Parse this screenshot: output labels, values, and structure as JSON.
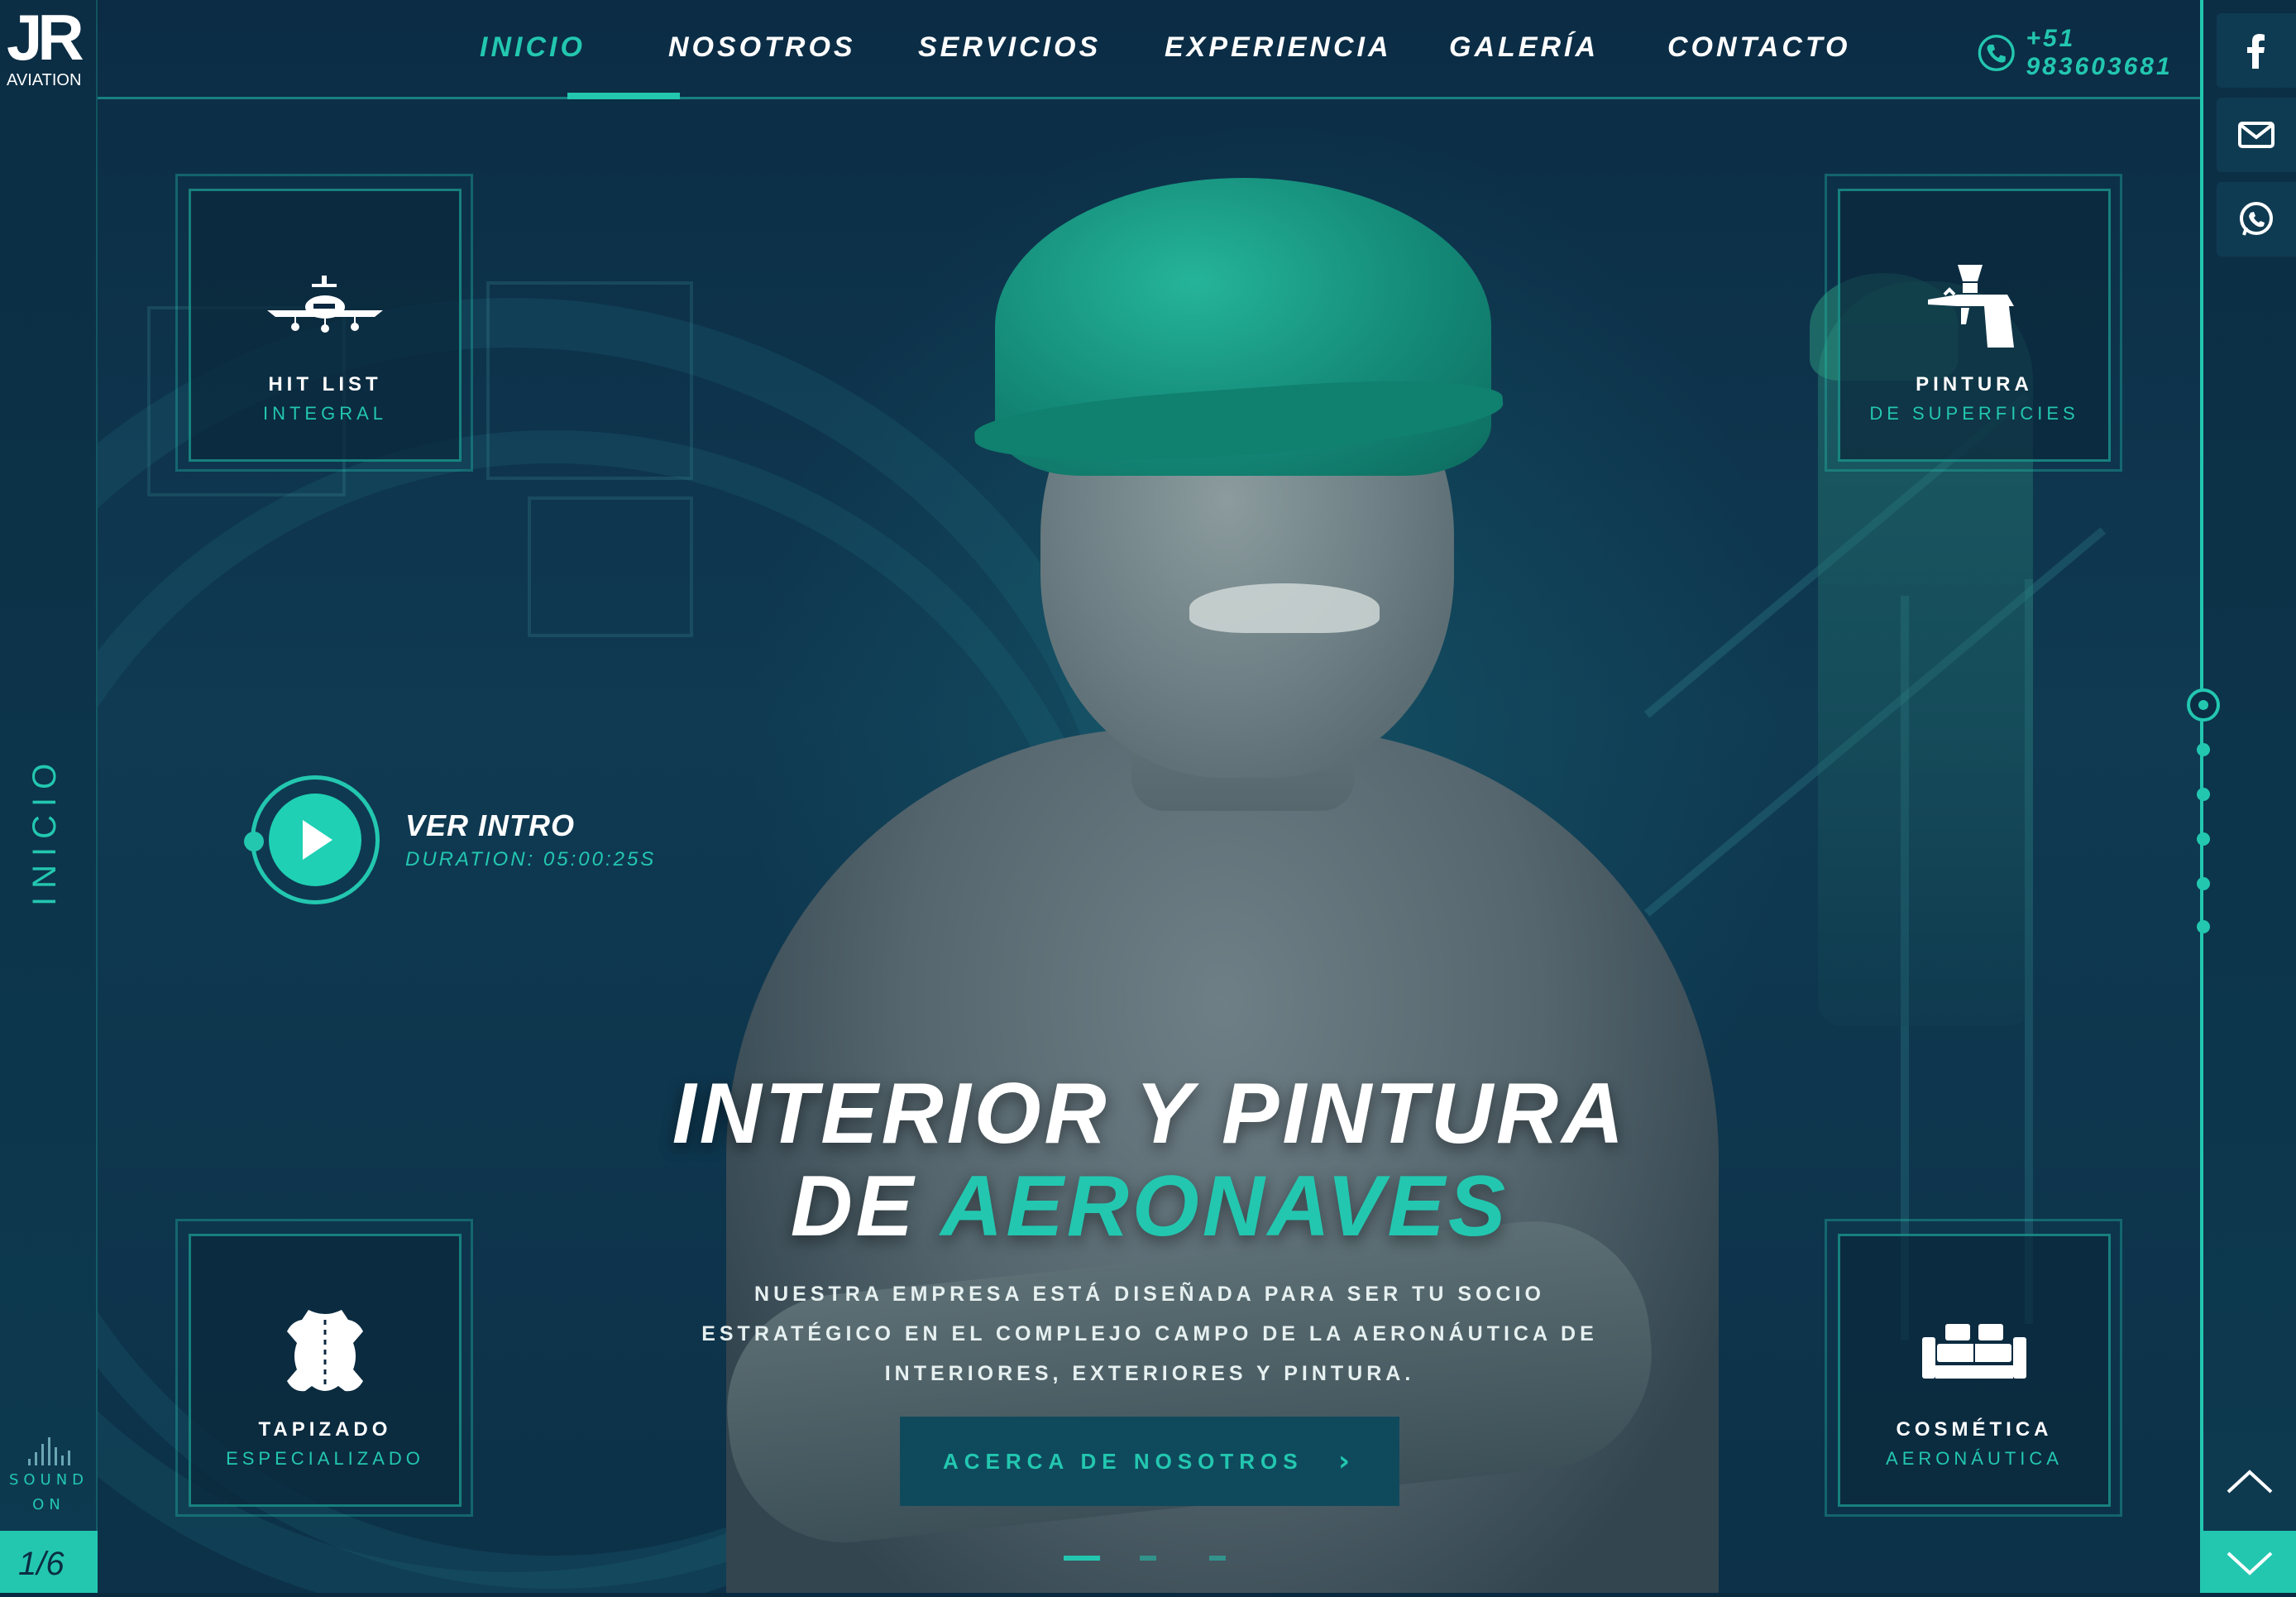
{
  "brand": {
    "logo_mark": "JR",
    "logo_sub": "AVIATION"
  },
  "nav": {
    "items": [
      {
        "label": "INICIO",
        "active": true
      },
      {
        "label": "NOSOTROS",
        "active": false
      },
      {
        "label": "SERVICIOS",
        "active": false
      },
      {
        "label": "EXPERIENCIA",
        "active": false
      },
      {
        "label": "GALERÍA",
        "active": false
      },
      {
        "label": "CONTACTO",
        "active": false
      }
    ],
    "phone": "+51 983603681"
  },
  "left_rail": {
    "section_label": "INICIO",
    "sound_label_1": "SOUND",
    "sound_label_2": "ON",
    "pager": "1/6"
  },
  "social": [
    "facebook-icon",
    "mail-icon",
    "whatsapp-icon"
  ],
  "cards": [
    {
      "icon": "airplane-icon",
      "title": "HIT LIST",
      "subtitle": "INTEGRAL"
    },
    {
      "icon": "spray-gun-icon",
      "title": "PINTURA",
      "subtitle": "DE SUPERFICIES"
    },
    {
      "icon": "leather-hide-icon",
      "title": "TAPIZADO",
      "subtitle": "ESPECIALIZADO"
    },
    {
      "icon": "sofa-icon",
      "title": "COSMÉTICA",
      "subtitle": "AERONÁUTICA"
    }
  ],
  "intro": {
    "title": "VER INTRO",
    "duration": "DURATION: 05:00:25S"
  },
  "hero": {
    "title_line1": "INTERIOR Y PINTURA",
    "title_line2_prefix": "DE ",
    "title_line2_accent": "AERONAVES",
    "description_lines": [
      "NUESTRA EMPRESA ESTÁ DISEÑADA PARA SER TU SOCIO",
      "ESTRATÉGICO EN EL COMPLEJO CAMPO DE LA AERONÁUTICA DE",
      "INTERIORES, EXTERIORES Y PINTURA."
    ],
    "cta_label": "ACERCA DE NOSOTROS",
    "cta_arrow": "›"
  },
  "slides": {
    "count": 6,
    "current": 1,
    "indicator_count": 3,
    "indicator_active": 1
  },
  "colors": {
    "accent": "#23c7b0",
    "background": "#0a2a40",
    "panel": "#0f3b52"
  }
}
